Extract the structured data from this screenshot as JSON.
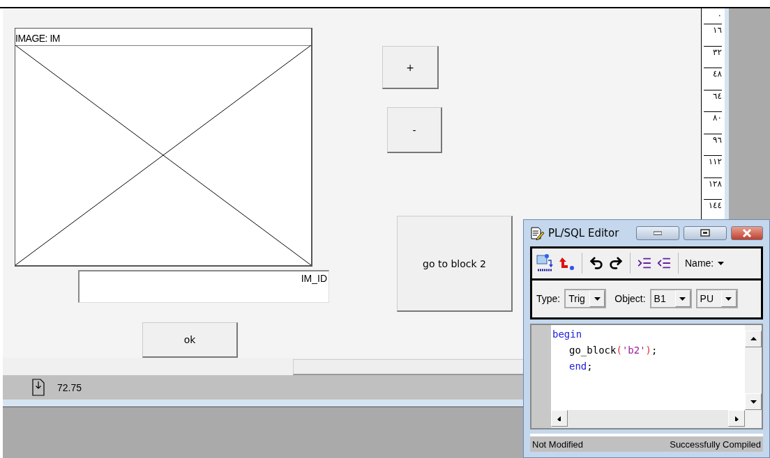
{
  "canvas": {
    "image_item": {
      "label": "IMAGE: IM"
    },
    "text_item": {
      "label": "IM_ID"
    },
    "buttons": [
      {
        "label": "+"
      },
      {
        "label": "-"
      },
      {
        "label": "go to block 2"
      },
      {
        "label": "ok"
      }
    ]
  },
  "ruler": {
    "marks": [
      "٠",
      "١٦",
      "٣٢",
      "٤٨",
      "٦٤",
      "٨٠",
      "٩٦",
      "١١٢",
      "١٢٨",
      "١٤٤"
    ]
  },
  "status_bar": {
    "value": "72.75"
  },
  "editor": {
    "title": "PL/SQL Editor",
    "name_label": "Name:",
    "type": {
      "label": "Type:",
      "value": "Trig"
    },
    "object": {
      "label": "Object:",
      "value": "B1"
    },
    "unit": {
      "value": "PU"
    },
    "code": [
      {
        "indented": false,
        "tokens": [
          {
            "kind": "keyword",
            "text": "begin"
          }
        ]
      },
      {
        "indented": true,
        "tokens": [
          {
            "kind": "plain",
            "text": "go_block"
          },
          {
            "kind": "punct",
            "text": "("
          },
          {
            "kind": "string",
            "text": "'b2'"
          },
          {
            "kind": "punct",
            "text": ")"
          },
          {
            "kind": "plain",
            "text": ";"
          }
        ]
      },
      {
        "indented": true,
        "tokens": [
          {
            "kind": "keyword",
            "text": "end"
          },
          {
            "kind": "plain",
            "text": ";"
          }
        ]
      }
    ],
    "status_left": "Not Modified",
    "status_right": "Successfully Compiled"
  }
}
